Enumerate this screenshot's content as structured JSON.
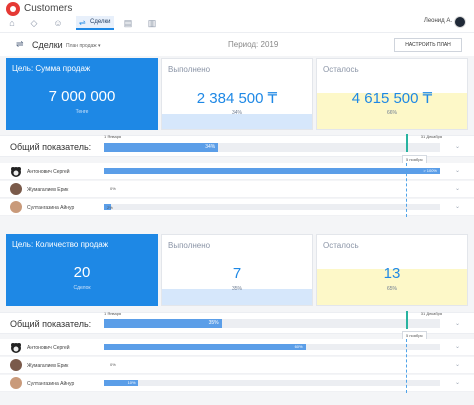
{
  "app": {
    "name": "Customers"
  },
  "nav": {
    "active_tab": "Сделки",
    "user_name": "Леонид А."
  },
  "subheader": {
    "title": "Сделки",
    "plan_dropdown": "План продаж",
    "period": "Период: 2019",
    "setup_button": "НАСТРОИТЬ ПЛАН"
  },
  "colors": {
    "accent": "#1e88e5",
    "done_fill": "#d6e7fb",
    "rest_fill": "#fdf8c8",
    "bar": "#5b9ee8",
    "today_marker": "#28b3a0"
  },
  "section1": {
    "goal": {
      "title": "Цель: Сумма продаж",
      "value": "7 000 000",
      "sub": "Тенге"
    },
    "done": {
      "title": "Выполнено",
      "value": "2 384 500 ₸",
      "sub": "34%",
      "fraction": 0.34
    },
    "rest": {
      "title": "Осталось",
      "value": "4 615 500 ₸",
      "sub": "66%",
      "fraction": 0.66
    },
    "overall": {
      "label": "Общий показатель:",
      "start": "1 Января",
      "end": "31 Декабря",
      "today": "5 ноября",
      "pct": "34%",
      "fraction": 0.34
    },
    "people": [
      {
        "name": "Антонович Сергей",
        "pct": "> 100%",
        "fraction": 1.0
      },
      {
        "name": "Жумагалиев Ерик",
        "pct": "0%",
        "fraction": 0.0
      },
      {
        "name": "Султангазина Айнур",
        "pct": "2%",
        "fraction": 0.02
      }
    ]
  },
  "section2": {
    "goal": {
      "title": "Цель: Количество продаж",
      "value": "20",
      "sub": "Сделок"
    },
    "done": {
      "title": "Выполнено",
      "value": "7",
      "sub": "35%",
      "fraction": 0.35
    },
    "rest": {
      "title": "Осталось",
      "value": "13",
      "sub": "65%",
      "fraction": 0.65
    },
    "overall": {
      "label": "Общий показатель:",
      "start": "1 Января",
      "end": "31 Декабря",
      "today": "5 ноября",
      "pct": "35%",
      "fraction": 0.35
    },
    "people": [
      {
        "name": "Антонович Сергей",
        "pct": "60%",
        "fraction": 0.6
      },
      {
        "name": "Жумагалиев Ерик",
        "pct": "0%",
        "fraction": 0.0
      },
      {
        "name": "Султангазина Айнур",
        "pct": "10%",
        "fraction": 0.1
      }
    ]
  },
  "timeline": {
    "today_fraction": 0.9
  }
}
